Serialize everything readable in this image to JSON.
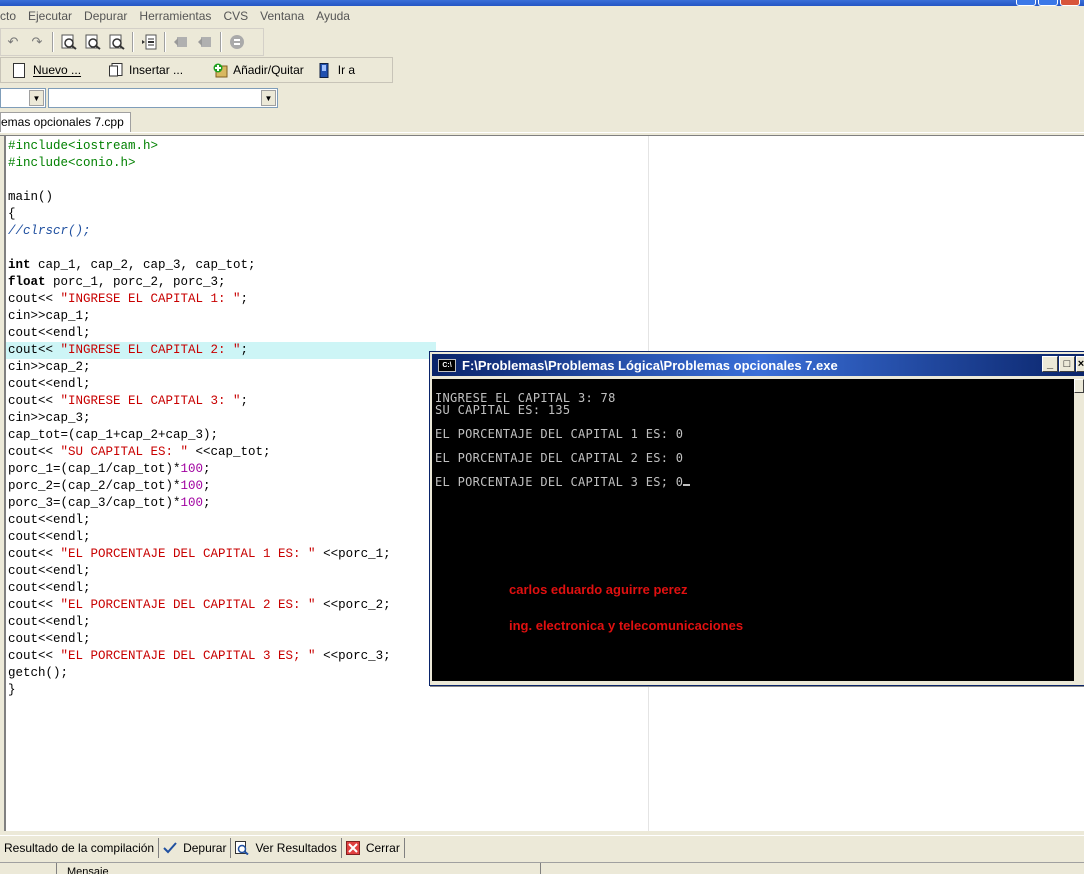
{
  "menu": [
    "cto",
    "Ejecutar",
    "Depurar",
    "Herramientas",
    "CVS",
    "Ventana",
    "Ayuda"
  ],
  "toolbar2": {
    "nuevo": "Nuevo ...",
    "insertar": "Insertar ...",
    "anadir": "Añadir/Quitar",
    "ira": "Ir a"
  },
  "tab": {
    "file": "emas opcionales 7.cpp"
  },
  "code": [
    "#include<iostream.h>",
    "#include<conio.h>",
    "",
    "main()",
    "{",
    "//clrscr();",
    "",
    "int cap_1, cap_2, cap_3, cap_tot;",
    "float porc_1, porc_2, porc_3;",
    "cout<< \"INGRESE EL CAPITAL 1: \";",
    "cin>>cap_1;",
    "cout<<endl;",
    "cout<< \"INGRESE EL CAPITAL 2: \";",
    "cin>>cap_2;",
    "cout<<endl;",
    "cout<< \"INGRESE EL CAPITAL 3: \";",
    "cin>>cap_3;",
    "cap_tot=(cap_1+cap_2+cap_3);",
    "cout<< \"SU CAPITAL ES: \" <<cap_tot;",
    "porc_1=(cap_1/cap_tot)*100;",
    "porc_2=(cap_2/cap_tot)*100;",
    "porc_3=(cap_3/cap_tot)*100;",
    "cout<<endl;",
    "cout<<endl;",
    "cout<< \"EL PORCENTAJE DEL CAPITAL 1 ES: \" <<porc_1;",
    "cout<<endl;",
    "cout<<endl;",
    "cout<< \"EL PORCENTAJE DEL CAPITAL 2 ES: \" <<porc_2;",
    "cout<<endl;",
    "cout<<endl;",
    "cout<< \"EL PORCENTAJE DEL CAPITAL 3 ES; \" <<porc_3;",
    "getch();",
    "}"
  ],
  "console": {
    "title": "F:\\Problemas\\Problemas Lógica\\Problemas opcionales 7.exe",
    "lines": [
      "INGRESE EL CAPITAL 3: 78",
      "SU CAPITAL ES: 135",
      "EL PORCENTAJE DEL CAPITAL 1 ES: 0",
      "EL PORCENTAJE DEL CAPITAL 2 ES: 0",
      "EL PORCENTAJE DEL CAPITAL 3 ES; 0"
    ],
    "author_name": "carlos eduardo aguirre perez",
    "author_program": "ing. electronica y telecomunicaciones"
  },
  "bottom_tabs": [
    "Resultado de la compilación",
    "Depurar",
    "Ver Resultados",
    "Cerrar"
  ],
  "status": {
    "message": "Mensaje"
  }
}
